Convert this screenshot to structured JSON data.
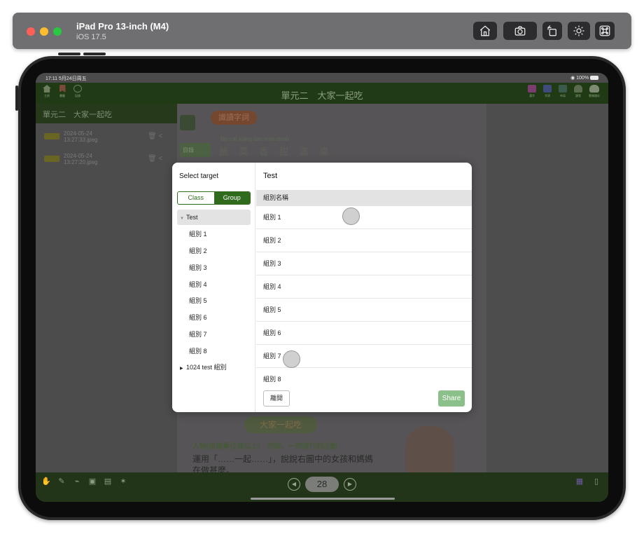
{
  "simulator": {
    "device": "iPad Pro 13-inch (M4)",
    "os": "iOS 17.5",
    "buttons": [
      "home-icon",
      "screenshot-icon",
      "rotate-icon",
      "brightness-icon",
      "command-icon"
    ]
  },
  "status_bar": {
    "time": "17:11  5月24日周五",
    "battery": "100%"
  },
  "nav": {
    "title": "單元二　大家一起吃",
    "left_icons": [
      {
        "icon": "home-icon",
        "label": "主頁"
      },
      {
        "icon": "bookmark-icon",
        "label": "書籤"
      },
      {
        "icon": "history-icon",
        "label": "記錄"
      }
    ],
    "right_icons": [
      {
        "icon": "chinese-icon",
        "label": "漢字"
      },
      {
        "icon": "dictionary-icon",
        "label": "字詞"
      },
      {
        "icon": "book-icon",
        "label": "布局"
      },
      {
        "icon": "group-icon",
        "label": "課堂"
      },
      {
        "icon": "cloud-icon",
        "label": "雲端儲存"
      }
    ]
  },
  "left_panel": {
    "header": "單元二　大家一起吃",
    "items": [
      {
        "date": "2024-05-24",
        "file": "13:27:33.jpeg"
      },
      {
        "date": "2024-05-24",
        "file": "13:27:20.jpeg"
      }
    ]
  },
  "book": {
    "banner": "識讀字詞",
    "chars": "飯 菜 香 甜 滿 桌",
    "pinyin": "fàn cài xiāng tián mǎn zhuō",
    "chapter": "大家一起吃",
    "line1": "人物(兩個單位或以上)　同做。一同進行的活動",
    "line2": "運用「……一起……」，說說右圖中的女孩和媽媽",
    "line3": "在做甚麼。",
    "side_tab": "目錄"
  },
  "toolbar": {
    "page": "28",
    "left_tools": [
      "hand-icon",
      "pen-icon",
      "clip-icon",
      "camera-icon",
      "notes-icon",
      "light-icon"
    ]
  },
  "modal": {
    "left_title": "Select target",
    "seg_class": "Class",
    "seg_group": "Group",
    "tree": {
      "root": "Test",
      "children": [
        "組別 1",
        "組別 2",
        "組別 3",
        "組別 4",
        "組別 5",
        "組別 6",
        "組別 7",
        "組別 8"
      ],
      "other": "1024 test 組別"
    },
    "right_title": "Test",
    "column_header": "組別名稱",
    "rows": [
      "組別 1",
      "組別 2",
      "組別 3",
      "組別 4",
      "組別 5",
      "組別 6",
      "組別 7",
      "組別 8"
    ],
    "leave_label": "離開",
    "share_label": "Share"
  },
  "colors": {
    "accent": "#2f6a1d",
    "share_disabled": "#8cc08a",
    "selection_bg": "#e3e3e3"
  }
}
